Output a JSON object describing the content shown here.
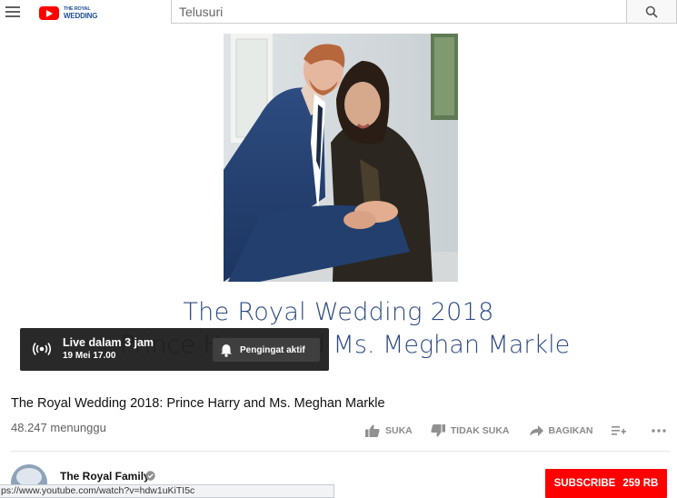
{
  "header": {
    "logo_line1": "THE ROYAL",
    "logo_line2": "WEDDING",
    "search_placeholder": "Telusuri"
  },
  "player": {
    "banner_line1": "The Royal Wedding 2018",
    "banner_line2": "Prince Harry and Ms. Meghan Markle",
    "live_label": "Live dalam 3 jam",
    "live_date": "19 Mei 17.00",
    "reminder_label": "Pengingat aktif"
  },
  "video": {
    "title": "The Royal Wedding 2018: Prince Harry and Ms. Meghan Markle",
    "waiting": "48.247 menunggu"
  },
  "actions": {
    "like": "SUKA",
    "dislike": "TIDAK SUKA",
    "share": "BAGIKAN"
  },
  "channel": {
    "name": "The Royal Family",
    "subscribe_label": "SUBSCRIBE",
    "subscriber_count": "259 RB"
  },
  "status_url": "ps://www.youtube.com/watch?v=hdw1uKiTI5c",
  "colors": {
    "accent_red": "#ff0000",
    "title_blue": "#2e4a82",
    "overlay_dark": "#1c1c1c"
  }
}
